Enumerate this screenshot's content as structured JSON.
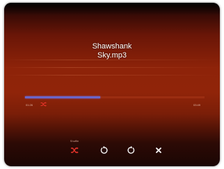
{
  "player": {
    "track_line1": "Shawshank",
    "track_line2": "Sky.mp3",
    "progress": 0.42,
    "elapsed": "01:26",
    "total": "03:49",
    "progress_color": "#6b66c8",
    "accent_color": "#e8332a"
  },
  "controls": {
    "shuffle_label": "Shuffle",
    "shuffle_icon": "shuffle-icon",
    "rewind_icon": "rewind-icon",
    "forward_icon": "forward-icon",
    "close_icon": "close-icon"
  }
}
